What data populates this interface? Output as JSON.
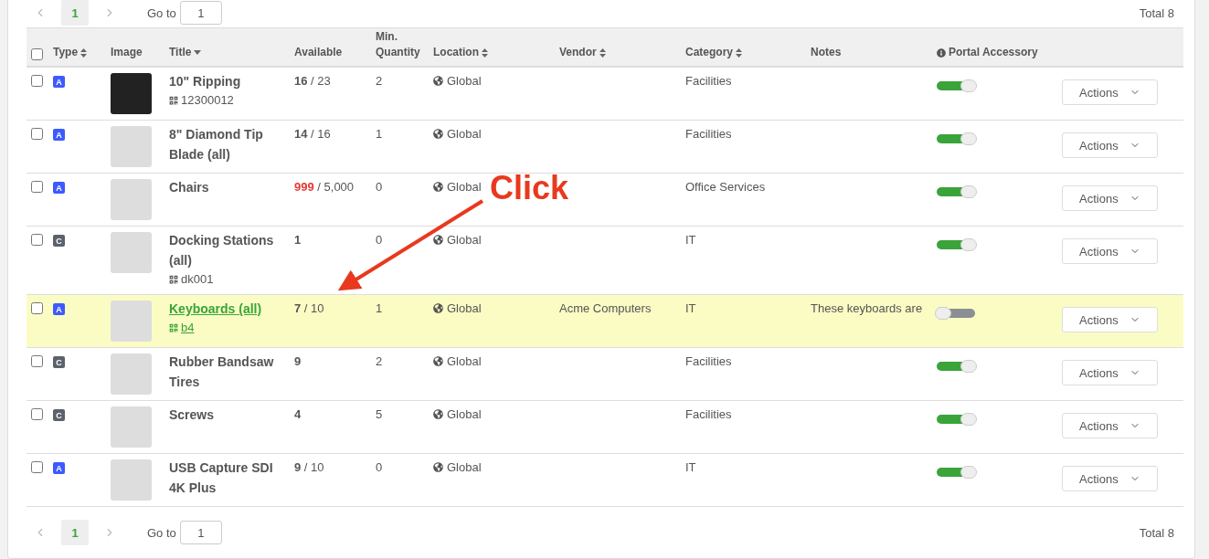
{
  "top_pager": {
    "page": "1",
    "goto_label": "Go to",
    "goto_value": "1",
    "total": "Total 8"
  },
  "table": {
    "select_all_checked": false,
    "columns": [
      {
        "label": "Type",
        "sortable": true,
        "sorted": false
      },
      {
        "label": "Image",
        "sortable": false
      },
      {
        "label": "Title",
        "sortable": true,
        "sorted": true
      },
      {
        "label": "Available",
        "sortable": false
      },
      {
        "label": "Min. Quantity",
        "sortable": false
      },
      {
        "label": "Location",
        "sortable": true,
        "sorted": false
      },
      {
        "label": "Vendor",
        "sortable": true,
        "sorted": false
      },
      {
        "label": "Category",
        "sortable": true,
        "sorted": false
      },
      {
        "label": "Notes",
        "sortable": false
      },
      {
        "label": "Portal Accessory",
        "sortable": false,
        "info": true
      }
    ],
    "rows": [
      {
        "checked": false,
        "selected": false,
        "type": "A",
        "color": "#3d5afe",
        "title": "10\" Ripping",
        "code": "12300012",
        "available": "16",
        "total": "/ 23",
        "alert": false,
        "min_qty": "2",
        "location": "Global",
        "vendor": "",
        "category": "Facilities",
        "notes": "",
        "portal": true,
        "action": "Actions"
      },
      {
        "checked": false,
        "selected": false,
        "type": "A",
        "color": "#3d5afe",
        "title": "8\" Diamond Tip Blade (all)",
        "code": "",
        "available": "14",
        "total": "/ 16",
        "alert": false,
        "min_qty": "1",
        "location": "Global",
        "vendor": "",
        "category": "Facilities",
        "notes": "",
        "portal": true,
        "action": "Actions"
      },
      {
        "checked": false,
        "selected": false,
        "type": "A",
        "color": "#3d5afe",
        "title": "Chairs",
        "code": "",
        "available": "999",
        "total": "/ 5,000",
        "alert": true,
        "min_qty": "0",
        "location": "Global",
        "vendor": "",
        "category": "Office Services",
        "notes": "",
        "portal": true,
        "action": "Actions"
      },
      {
        "checked": false,
        "selected": false,
        "type": "C",
        "color": "#5b626b",
        "title": "Docking Stations (all)",
        "code": "dk001",
        "available": "1",
        "total": "",
        "alert": false,
        "min_qty": "0",
        "location": "Global",
        "vendor": "",
        "category": "IT",
        "notes": "",
        "portal": true,
        "action": "Actions"
      },
      {
        "checked": false,
        "selected": true,
        "type": "A",
        "color": "#3d5afe",
        "title": "Keyboards (all)",
        "code": "b4",
        "available": "7",
        "total": "/ 10",
        "alert": false,
        "min_qty": "1",
        "location": "Global",
        "vendor": "Acme Computers",
        "category": "IT",
        "notes": "These keyboards are",
        "portal": false,
        "action": "Actions"
      },
      {
        "checked": false,
        "selected": false,
        "type": "C",
        "color": "#5b626b",
        "title": "Rubber Bandsaw Tires",
        "code": "",
        "available": "9",
        "total": "",
        "alert": false,
        "min_qty": "2",
        "location": "Global",
        "vendor": "",
        "category": "Facilities",
        "notes": "",
        "portal": true,
        "action": "Actions"
      },
      {
        "checked": false,
        "selected": false,
        "type": "C",
        "color": "#5b626b",
        "title": "Screws",
        "code": "",
        "available": "4",
        "total": "",
        "alert": false,
        "min_qty": "5",
        "location": "Global",
        "vendor": "",
        "category": "Facilities",
        "notes": "",
        "portal": true,
        "action": "Actions"
      },
      {
        "checked": false,
        "selected": false,
        "type": "A",
        "color": "#3d5afe",
        "title": "USB Capture SDI 4K Plus",
        "code": "",
        "available": "9",
        "total": "/ 10",
        "alert": false,
        "min_qty": "0",
        "location": "Global",
        "vendor": "",
        "category": "IT",
        "notes": "",
        "portal": true,
        "action": "Actions"
      }
    ]
  },
  "bottom_pager": {
    "page": "1",
    "goto_label": "Go to",
    "goto_value": "1",
    "total": "Total 8"
  },
  "annotation": {
    "text": "Click"
  }
}
